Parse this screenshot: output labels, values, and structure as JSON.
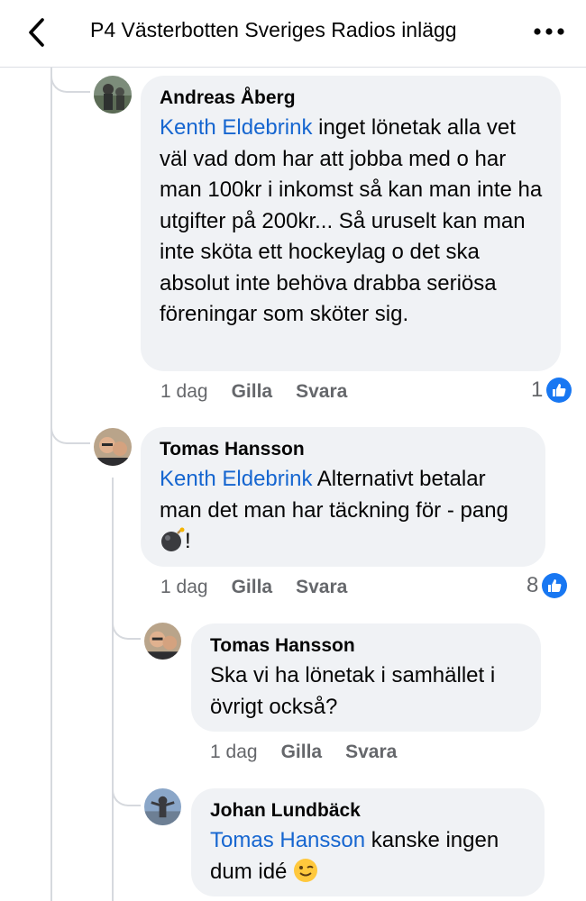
{
  "header": {
    "title": "P4 Västerbotten Sveriges Radios inlägg",
    "back_icon": "chevron-left-icon",
    "more_icon": "more-horizontal-icon"
  },
  "comments": [
    {
      "author": "Andreas Åberg",
      "mention": "Kenth Eldebrink",
      "text": " inget lönetak alla vet väl vad dom har att jobba med o har man 100kr i inkomst så kan man inte ha utgifter på 200kr... Så uruselt kan man inte sköta ett hockeylag o det ska absolut inte behöva drabba seriösa föreningar som sköter sig.",
      "time": "1 dag",
      "like_label": "Gilla",
      "reply_label": "Svara",
      "likes": "1"
    },
    {
      "author": "Tomas Hansson",
      "mention": "Kenth Eldebrink",
      "text": " Alternativt betalar man det man har täckning för - pang",
      "text_end": "!",
      "emoji": "bomb",
      "time": "1 dag",
      "like_label": "Gilla",
      "reply_label": "Svara",
      "likes": "8"
    },
    {
      "author": "Tomas Hansson",
      "text": "Ska vi ha lönetak i samhället i övrigt också?",
      "time": "1 dag",
      "like_label": "Gilla",
      "reply_label": "Svara"
    },
    {
      "author": "Johan Lundbäck",
      "mention": "Tomas Hansson",
      "text": " kanske ingen dum idé ",
      "emoji": "winking-face"
    }
  ],
  "colors": {
    "mention": "#1666d0",
    "bubble": "#f0f2f5",
    "like": "#1877f2",
    "meta": "#65676b"
  }
}
